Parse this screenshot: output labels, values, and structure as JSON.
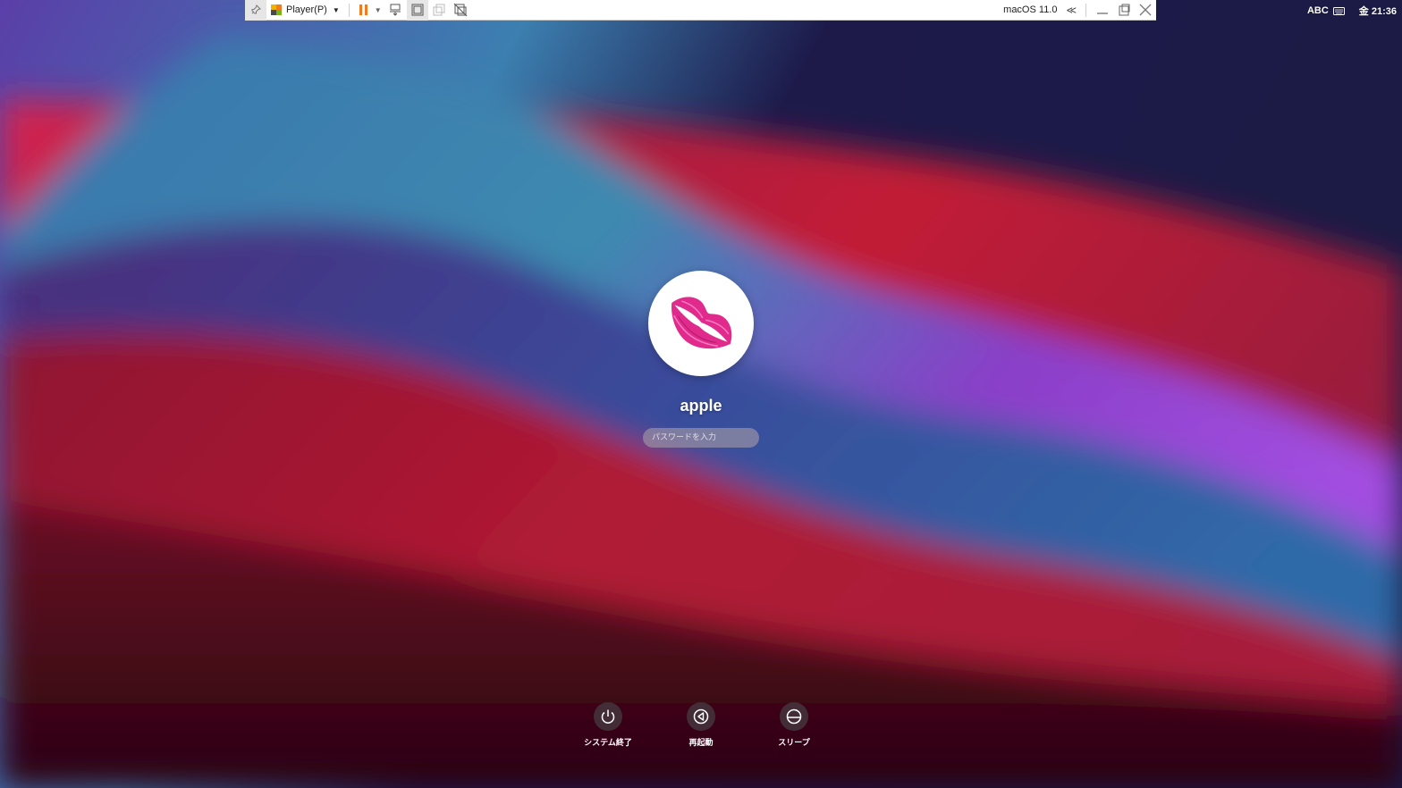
{
  "vm_toolbar": {
    "player_menu": "Player(P)",
    "vm_name": "macOS 11.0",
    "icons": [
      "pin-icon",
      "player-icon",
      "pause-icon",
      "send-ctrl-alt-del-icon",
      "fullscreen-icon",
      "unity-icon",
      "exit-unity-icon",
      "collapse-icon",
      "minimize-icon",
      "restore-icon",
      "close-icon"
    ],
    "accent_color": "#f47920"
  },
  "menubar": {
    "input_source": "ABC",
    "clock": "金 21:36"
  },
  "login": {
    "username": "apple",
    "password_placeholder": "パスワードを入力",
    "avatar_icon": "lips-icon"
  },
  "power_options": {
    "shutdown": "システム終了",
    "restart": "再起動",
    "sleep": "スリープ"
  }
}
